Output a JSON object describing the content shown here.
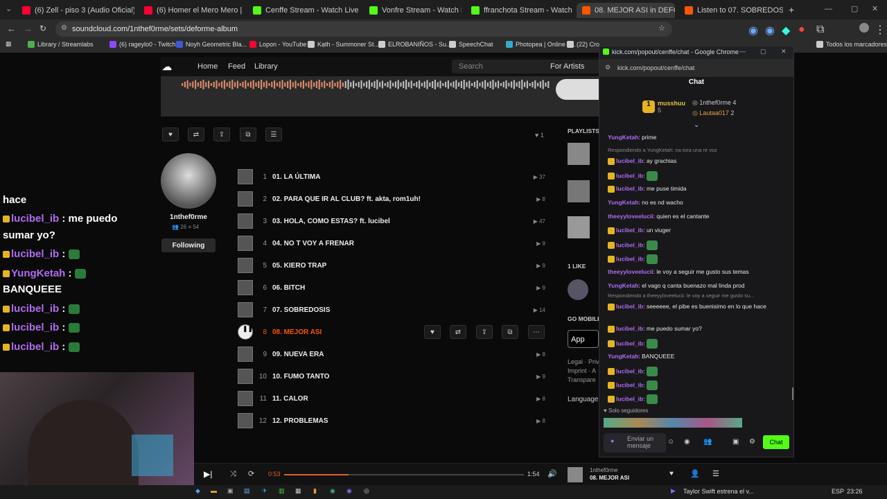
{
  "browser": {
    "tabs": [
      {
        "title": "(6) Zell - piso 3 (Audio Oficial)",
        "color": "#ff0033"
      },
      {
        "title": "(6) Homer el Mero Mero | SHC",
        "color": "#ff0033"
      },
      {
        "title": "Cenffe Stream - Watch Live on",
        "color": "#53fc18"
      },
      {
        "title": "Vonfre Stream - Watch Li",
        "color": "#53fc18"
      },
      {
        "title": "ffranchota Stream - Watch",
        "color": "#53fc18"
      },
      {
        "title": "08. MEJOR ASI in DEFORM",
        "color": "#ff5500"
      },
      {
        "title": "Listen to 07. SOBREDOSIS by",
        "color": "#ff5500"
      }
    ],
    "url": "soundcloud.com/1nthef0rme/sets/deforme-album",
    "bookmarks": [
      "Library / Streamlabs",
      "(6) rageylo0 - Twitch",
      "Noyh Geometric Bla...",
      "Lopon - YouTube",
      "Kạth - Summoner St...",
      "ELROBANIÑOS - Su...",
      "SpeechChat",
      "Photopea | Online P...",
      "(22) Cro",
      "Todos los marcadores"
    ]
  },
  "soundcloud": {
    "nav": {
      "home": "Home",
      "feed": "Feed",
      "library": "Library",
      "search_placeholder": "Search",
      "for_artists": "For Artists"
    },
    "artist": {
      "name": "1nthef0rme",
      "followers": "26",
      "following": "54",
      "follow_btn": "Following"
    },
    "likes_count": "1",
    "tracks": [
      {
        "n": "1",
        "title": "01. LA ÚLTIMA",
        "plays": "37"
      },
      {
        "n": "2",
        "title": "02. PARA QUE IR AL CLUB? ft. akta, rom1uh!",
        "plays": "8"
      },
      {
        "n": "3",
        "title": "03. HOLA, COMO ESTAS? ft. lucibel",
        "plays": "47"
      },
      {
        "n": "4",
        "title": "04. NO T VOY A FRENAR",
        "plays": "9"
      },
      {
        "n": "5",
        "title": "05. KIERO TRAP",
        "plays": "9"
      },
      {
        "n": "6",
        "title": "06. BITCH",
        "plays": "9"
      },
      {
        "n": "7",
        "title": "07. SOBREDOSIS",
        "plays": "14"
      },
      {
        "n": "8",
        "title": "08. MEJOR ASI",
        "plays": ""
      },
      {
        "n": "9",
        "title": "09. NUEVA ERA",
        "plays": "8"
      },
      {
        "n": "10",
        "title": "10. FUMO TANTO",
        "plays": "9"
      },
      {
        "n": "11",
        "title": "11. CALOR",
        "plays": "8"
      },
      {
        "n": "12",
        "title": "12. PROBLEMAS",
        "plays": "8"
      }
    ],
    "sidebar": {
      "playlists": "PLAYLISTS",
      "likes": "1 LIKE",
      "go_mobile": "GO MOBILE",
      "app_btn": "App",
      "legal": "Legal · Priv",
      "imprint": "Imprint · A",
      "transparency": "Transpare",
      "language": "Language:"
    },
    "player": {
      "elapsed": "0:53",
      "duration": "1:54",
      "progress": 0.27,
      "artist": "1nthef0rme",
      "track": "08. MEJOR ASI"
    }
  },
  "overlay_chat": [
    {
      "user": "",
      "msg": "hace"
    },
    {
      "user": "lucibel_ib",
      "msg": " : me puedo"
    },
    {
      "user": "",
      "msg": "sumar yo?"
    },
    {
      "user": "lucibel_ib",
      "msg": " : "
    },
    {
      "user": "YungKetah",
      "msg": " : "
    },
    {
      "user": "",
      "msg": "BANQUEEE"
    },
    {
      "user": "lucibel_ib",
      "msg": " : "
    },
    {
      "user": "lucibel_ib",
      "msg": " : "
    },
    {
      "user": "lucibel_ib",
      "msg": " : "
    }
  ],
  "kick": {
    "window_title": "kick.com/popout/cenffe/chat - Google Chrome",
    "url": "kick.com/popout/cenffe/chat",
    "header": "Chat",
    "leaders": [
      {
        "name": "musshuu",
        "count": "5"
      },
      {
        "name": "1nthef0rme",
        "count": "4"
      },
      {
        "name": "Lautaa017",
        "count": "2"
      }
    ],
    "messages": [
      {
        "user": "YungKetah",
        "color": "#b06cf0",
        "text": ": prime"
      },
      {
        "reply": "Respondiendo a YungKetah: na tora una re voz"
      },
      {
        "user": "lucibel_ib",
        "color": "#b06cf0",
        "text": ": ay grachias"
      },
      {
        "user": "lucibel_ib",
        "color": "#b06cf0",
        "text": ":"
      },
      {
        "user": "lucibel_ib",
        "color": "#b06cf0",
        "text": ": me puse timida"
      },
      {
        "user": "YungKetah",
        "color": "#b06cf0",
        "text": ": no es nd wacho"
      },
      {
        "user": "theeyyloveelucii",
        "color": "#b06cf0",
        "text": ": quien es el cantante"
      },
      {
        "user": "lucibel_ib",
        "color": "#b06cf0",
        "text": ": un viuger"
      },
      {
        "user": "lucibel_ib",
        "color": "#b06cf0",
        "text": ":"
      },
      {
        "user": "lucibel_ib",
        "color": "#b06cf0",
        "text": ":"
      },
      {
        "user": "theeyyloveelucii",
        "color": "#b06cf0",
        "text": ": le voy a seguir me gusto sus temas"
      },
      {
        "user": "YungKetah",
        "color": "#b06cf0",
        "text": ": el vago q canta buenazo mal linda prod"
      },
      {
        "reply": "Respondiendo a theeyyloveelucii: le voy a seguir me gusto su..."
      },
      {
        "user": "lucibel_ib",
        "color": "#b06cf0",
        "text": ": seeeeee, el pibe es buenisimo en lo que hace"
      },
      {
        "user": "lucibel_ib",
        "color": "#b06cf0",
        "text": ": me puedo sumar yo?"
      },
      {
        "user": "lucibel_ib",
        "color": "#b06cf0",
        "text": ":"
      },
      {
        "user": "YungKetah",
        "color": "#b06cf0",
        "text": ": BANQUEEE"
      },
      {
        "user": "lucibel_ib",
        "color": "#b06cf0",
        "text": ":"
      },
      {
        "user": "lucibel_ib",
        "color": "#b06cf0",
        "text": ":"
      },
      {
        "user": "lucibel_ib",
        "color": "#b06cf0",
        "text": ":"
      }
    ],
    "followers_only": "Solo seguidores",
    "input_placeholder": "Enviar un mensaje",
    "send_btn": "Chat"
  },
  "taskbar": {
    "news": "Taylor Swift estrena el v...",
    "lang": "ESP",
    "time": "23:26"
  }
}
